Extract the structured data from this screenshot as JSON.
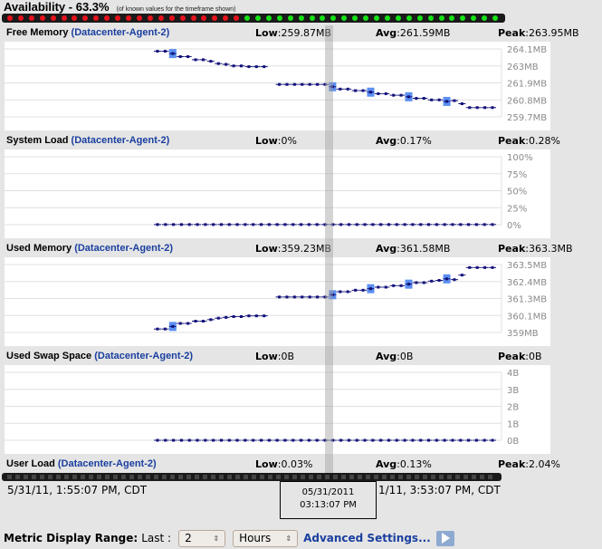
{
  "availability": {
    "title": "Availability - 63.3%",
    "note": "(of known values for the timeframe shown)",
    "percent": 63.3,
    "red_count": 22,
    "green_count": 24,
    "colors": {
      "down": "#e8121c",
      "up": "#16e216"
    }
  },
  "chart_data": [
    {
      "type": "line",
      "title": "Free Memory",
      "agent": "(Datacenter-Agent-2)",
      "low_label": "Low",
      "low": "259.87MB",
      "avg_label": "Avg",
      "avg": "261.59MB",
      "peak_label": "Peak",
      "peak": "263.95MB",
      "ytick_labels": [
        "264.1MB",
        "263MB",
        "261.9MB",
        "260.8MB",
        "259.7MB"
      ],
      "ylim": [
        259.7,
        264.1
      ],
      "values": [
        263.95,
        263.95,
        263.8,
        263.6,
        263.6,
        263.4,
        263.4,
        263.3,
        263.15,
        263.1,
        263.0,
        263.0,
        262.95,
        262.95,
        262.95,
        null,
        261.8,
        261.8,
        261.8,
        261.8,
        261.8,
        261.8,
        261.8,
        261.65,
        261.5,
        261.5,
        261.4,
        261.4,
        261.3,
        261.2,
        261.2,
        261.1,
        261.1,
        261.0,
        260.9,
        260.9,
        260.8,
        260.8,
        260.7,
        260.75,
        260.55,
        260.3,
        260.3,
        260.3,
        260.3
      ],
      "highlighted_indices": [
        2,
        23,
        28,
        33,
        38
      ],
      "color": "#10107a"
    },
    {
      "type": "line",
      "title": "System Load",
      "agent": "(Datacenter-Agent-2)",
      "low_label": "Low",
      "low": "0%",
      "avg_label": "Avg",
      "avg": "0.17%",
      "peak_label": "Peak",
      "peak": "0.28%",
      "ytick_labels": [
        "100%",
        "75%",
        "50%",
        "25%",
        "0%"
      ],
      "ylim": [
        0,
        100
      ],
      "values": [
        0.2,
        0.2,
        0.2,
        0.2,
        0.2,
        0.2,
        0.2,
        0.2,
        0.2,
        0.2,
        0.2,
        0.2,
        0.2,
        0.2,
        0.2,
        0.2,
        0.2,
        0.2,
        0.2,
        0.2,
        0.2,
        0.2,
        0.2,
        0.2,
        0.2,
        0.2,
        0.2,
        0.2,
        0.2,
        0.2,
        0.2,
        0.2,
        0.2,
        0.2,
        0.2,
        0.2,
        0.2,
        0.2,
        0.2,
        0.2,
        0.2,
        0.2,
        0.2
      ],
      "highlighted_indices": [],
      "color": "#10107a"
    },
    {
      "type": "line",
      "title": "Used Memory",
      "agent": "(Datacenter-Agent-2)",
      "low_label": "Low",
      "low": "359.23MB",
      "avg_label": "Avg",
      "avg": "361.58MB",
      "peak_label": "Peak",
      "peak": "363.3MB",
      "ytick_labels": [
        "363.5MB",
        "362.4MB",
        "361.3MB",
        "360.1MB",
        "359MB"
      ],
      "ylim": [
        359.0,
        363.5
      ],
      "values": [
        359.23,
        359.23,
        359.4,
        359.6,
        359.6,
        359.75,
        359.75,
        359.85,
        359.95,
        360.0,
        360.05,
        360.05,
        360.1,
        360.1,
        360.1,
        null,
        361.35,
        361.35,
        361.35,
        361.35,
        361.35,
        361.35,
        361.35,
        361.5,
        361.7,
        361.7,
        361.8,
        361.8,
        361.9,
        362.0,
        362.0,
        362.1,
        362.1,
        362.2,
        362.3,
        362.3,
        362.4,
        362.45,
        362.55,
        362.5,
        362.8,
        363.3,
        363.3,
        363.3,
        363.3
      ],
      "highlighted_indices": [
        2,
        23,
        28,
        33,
        38
      ],
      "color": "#10107a"
    },
    {
      "type": "line",
      "title": "Used Swap Space",
      "agent": "(Datacenter-Agent-2)",
      "low_label": "Low",
      "low": "0B",
      "avg_label": "Avg",
      "avg": "0B",
      "peak_label": "Peak",
      "peak": "0B",
      "ytick_labels": [
        "4B",
        "3B",
        "2B",
        "1B",
        "0B"
      ],
      "ylim": [
        0,
        4
      ],
      "values": [
        0,
        0,
        0,
        0,
        0,
        0,
        0,
        0,
        0,
        0,
        0,
        0,
        0,
        0,
        0,
        0,
        0,
        0,
        0,
        0,
        0,
        0,
        0,
        0,
        0,
        0,
        0,
        0,
        0,
        0,
        0,
        0,
        0,
        0,
        0,
        0,
        0,
        0,
        0,
        0,
        0,
        0,
        0
      ],
      "highlighted_indices": [],
      "color": "#10107a"
    },
    {
      "type": "line",
      "title": "User Load",
      "agent": "(Datacenter-Agent-2)",
      "low_label": "Low",
      "low": "0.03%",
      "avg_label": "Avg",
      "avg": "0.13%",
      "peak_label": "Peak",
      "peak": "2.04%",
      "ytick_labels": [],
      "values": [],
      "highlighted_indices": []
    }
  ],
  "timeline": {
    "start": "5/31/11, 1:55:07 PM, CDT",
    "end": "1/11, 3:53:07 PM, CDT",
    "cursor_date": "05/31/2011",
    "cursor_time": "03:13:07 PM"
  },
  "controls": {
    "range_label": "Metric Display Range:",
    "last_label": "Last :",
    "count_value": "2",
    "unit_value": "Hours",
    "advanced_label": "Advanced Settings...",
    "go_icon": "play-arrow-icon"
  }
}
